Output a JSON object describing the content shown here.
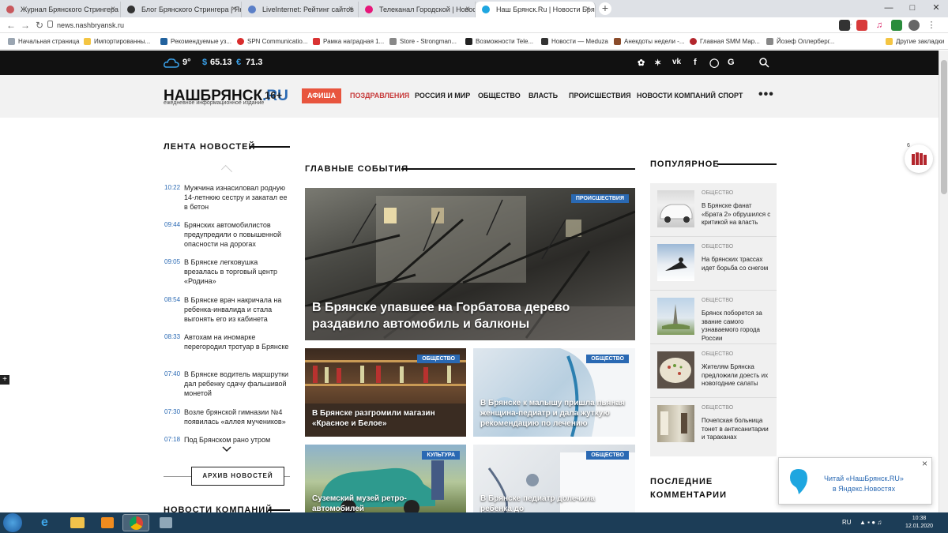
{
  "browser": {
    "tabs": [
      {
        "label": "Журнал Брянского Стрингера",
        "color": "#c8585d"
      },
      {
        "label": "Блог Брянского Стрингера | Ян",
        "color": "#333"
      },
      {
        "label": "LiveInternet: Рейтинг сайтов",
        "color": "#5b7fc7"
      },
      {
        "label": "Телеканал Городской | Новост",
        "color": "#e6177a"
      },
      {
        "label": "Наш Брянск.Ru | Новости Брян",
        "color": "#1ea6e0"
      }
    ],
    "close_glyph": "×",
    "new_tab_glyph": "+",
    "url": "news.nashbryansk.ru",
    "bookmarks": [
      {
        "label": "Начальная страница",
        "color": "#9aa5b1"
      },
      {
        "label": "Импортированны...",
        "color": "#f4c542"
      },
      {
        "label": "Рекомендуемые уз...",
        "color": "#22629e"
      },
      {
        "label": "SPN Communicatio...",
        "color": "#d92d2d"
      },
      {
        "label": "Рамка наградная 1...",
        "color": "#d93232"
      },
      {
        "label": "Store - Strongman...",
        "color": "#888"
      },
      {
        "label": "Возможности Tele...",
        "color": "#222"
      },
      {
        "label": "Новости — Meduza",
        "color": "#333"
      },
      {
        "label": "Анекдоты недели -...",
        "color": "#8a4b2a"
      },
      {
        "label": "Главная SMM Мар...",
        "color": "#b3262d"
      },
      {
        "label": "Йозеф Оллерберг...",
        "color": "#888"
      },
      {
        "label": "Другие закладки",
        "color": "#f4c542"
      }
    ]
  },
  "topbar": {
    "temperature": "9°",
    "usd": "65.13",
    "eur": "71.3",
    "usd_sign": "$",
    "eur_sign": "€"
  },
  "header": {
    "logo_main": "НАШБРЯНСК",
    "logo_ru": ".RU",
    "logo_sub": "ежедневное информационное издание",
    "age": "16+",
    "nav": [
      "Афиша",
      "Поздравления",
      "Россия и мир",
      "Общество",
      "Власть",
      "Происшествия",
      "Новости компаний",
      "Спорт"
    ],
    "more": "•••"
  },
  "feed": {
    "title": "ЛЕНТА НОВОСТЕЙ",
    "items": [
      {
        "time": "10:22",
        "text": "Мужчина изнасиловал родную 14-летнюю сестру и закатал ее в бетон"
      },
      {
        "time": "09:44",
        "text": "Брянских автомобилистов предупредили о повышенной опасности на дорогах"
      },
      {
        "time": "09:05",
        "text": "В Брянске легковушка врезалась в торговый центр «Родина»"
      },
      {
        "time": "08:54",
        "text": "В Брянске врач накричала на ребенка-инвалида и стала выгонять его из кабинета"
      },
      {
        "time": "08:33",
        "text": "Автохам на иномарке перегородил тротуар в Брянске"
      },
      {
        "time": "07:40",
        "text": "В Брянске водитель маршрутки дал ребенку сдачу фальшивой монетой"
      },
      {
        "time": "07:30",
        "text": "Возле брянской гимназии №4 появилась «аллея мучеников»"
      },
      {
        "time": "07:18",
        "text": "Под Брянском рано утром"
      }
    ],
    "archive": "АРХИВ НОВОСТЕЙ",
    "companies_title": "НОВОСТИ КОМПАНИЙ"
  },
  "main": {
    "title": "ГЛАВНЫЕ СОБЫТИЯ",
    "hero": {
      "badge": "Происшествия",
      "title": "В Брянске упавшее на Горбатова дерево раздавило автомобиль и балконы"
    },
    "cards": [
      {
        "badge": "Общество",
        "title": "В Брянске разгромили магазин «Красное и Белое»"
      },
      {
        "badge": "Общество",
        "title": "В Брянске к малышу пришла пьяная женщина-педиатр и дала жуткую рекомендацию по лечению"
      },
      {
        "badge": "Культура",
        "title": "Суземский музей ретро-автомобилей"
      },
      {
        "badge": "Общество",
        "title": "В Брянске педиатр долечила ребенка до"
      }
    ]
  },
  "popular": {
    "title": "ПОПУЛЯРНОЕ",
    "items": [
      {
        "cat": "Общество",
        "text": "В Брянске фанат «Брата 2» обрушился с критикой на власть"
      },
      {
        "cat": "Общество",
        "text": "На брянских трассах идет борьба со снегом"
      },
      {
        "cat": "Общество",
        "text": "Брянск поборется за звание самого узнаваемого города России"
      },
      {
        "cat": "Общество",
        "text": "Жителям Брянска предложили доесть их новогодние салаты"
      },
      {
        "cat": "Общество",
        "text": "Почепская больница тонет в антисанитарии и тараканах"
      }
    ],
    "comments_title_1": "ПОСЛЕДНИЕ",
    "comments_title_2": "КОММЕНТАРИИ"
  },
  "widget": {
    "count": "6"
  },
  "yandex": {
    "line1": "Читай «НашБрянск.RU»",
    "line2": "в Яндекс.Новостях",
    "close": "×"
  },
  "taskbar": {
    "lang": "RU",
    "time": "10:38",
    "date": "12.01.2020"
  }
}
